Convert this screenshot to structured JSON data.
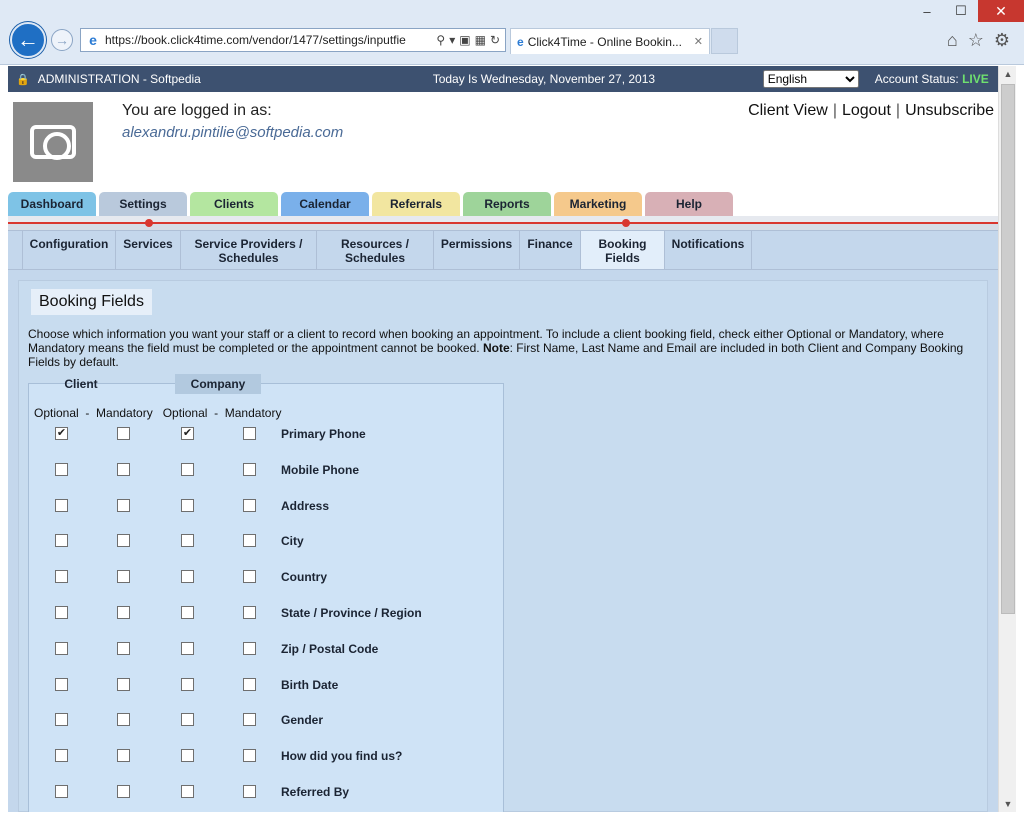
{
  "browser": {
    "window_controls": {
      "minimize": "–",
      "maximize": "☐",
      "close": "✕"
    },
    "address_bar": {
      "url": "https://book.click4time.com/vendor/1477/settings/inputfie"
    },
    "tab": {
      "title": "Click4Time - Online Bookin...",
      "close": "✕"
    },
    "toolbar_icons": [
      "home-icon",
      "star-icon",
      "gear-icon"
    ]
  },
  "topbar": {
    "admin_label": "ADMINISTRATION - Softpedia",
    "date_text": "Today Is Wednesday, November 27, 2013",
    "language": {
      "selected": "English"
    },
    "account_status_label": "Account Status:",
    "account_status_value": "LIVE"
  },
  "user": {
    "logged_in_label": "You are logged in as:",
    "email": "alexandru.pintilie@softpedia.com",
    "links": [
      "Client View",
      "Logout",
      "Unsubscribe"
    ],
    "separator": "|"
  },
  "main_nav": {
    "tabs": [
      {
        "label": "Dashboard",
        "color": "#7ec3e6"
      },
      {
        "label": "Settings",
        "color": "#b9c9dc"
      },
      {
        "label": "Clients",
        "color": "#b4e6a0"
      },
      {
        "label": "Calendar",
        "color": "#7ab0ea"
      },
      {
        "label": "Referrals",
        "color": "#f2e6a0"
      },
      {
        "label": "Reports",
        "color": "#9ed49a"
      },
      {
        "label": "Marketing",
        "color": "#f5c98c"
      },
      {
        "label": "Help",
        "color": "#d8b0b6"
      }
    ],
    "active": "Settings"
  },
  "sub_nav": {
    "tabs": [
      {
        "line1": "Configuration",
        "line2": ""
      },
      {
        "line1": "Services",
        "line2": ""
      },
      {
        "line1": "Service Providers /",
        "line2": "Schedules"
      },
      {
        "line1": "Resources /",
        "line2": "Schedules"
      },
      {
        "line1": "Permissions",
        "line2": ""
      },
      {
        "line1": "Finance",
        "line2": ""
      },
      {
        "line1": "Booking",
        "line2": "Fields"
      },
      {
        "line1": "Notifications",
        "line2": ""
      }
    ],
    "active": "Booking Fields"
  },
  "page": {
    "title": "Booking Fields",
    "intro": "Choose which information you want your staff or a client to record when booking an appointment. To include a client booking field, check either Optional or Mandatory, where Mandatory means the field must be completed or the appointment cannot be booked.",
    "note_label": "Note",
    "note_text": ": First Name, Last Name and Email are included in both Client and Company Booking Fields by default."
  },
  "fields_table": {
    "col_client": "Client",
    "col_company": "Company",
    "subheads": "Optional  -  Mandatory   Optional  -  Mandatory",
    "rows": [
      {
        "label": "Primary Phone",
        "client_optional": true,
        "client_mandatory": false,
        "company_optional": true,
        "company_mandatory": false
      },
      {
        "label": "Mobile Phone",
        "client_optional": false,
        "client_mandatory": false,
        "company_optional": false,
        "company_mandatory": false
      },
      {
        "label": "Address",
        "client_optional": false,
        "client_mandatory": false,
        "company_optional": false,
        "company_mandatory": false
      },
      {
        "label": "City",
        "client_optional": false,
        "client_mandatory": false,
        "company_optional": false,
        "company_mandatory": false
      },
      {
        "label": "Country",
        "client_optional": false,
        "client_mandatory": false,
        "company_optional": false,
        "company_mandatory": false
      },
      {
        "label": "State / Province / Region",
        "client_optional": false,
        "client_mandatory": false,
        "company_optional": false,
        "company_mandatory": false
      },
      {
        "label": "Zip / Postal Code",
        "client_optional": false,
        "client_mandatory": false,
        "company_optional": false,
        "company_mandatory": false
      },
      {
        "label": "Birth Date",
        "client_optional": false,
        "client_mandatory": false,
        "company_optional": false,
        "company_mandatory": false
      },
      {
        "label": "Gender",
        "client_optional": false,
        "client_mandatory": false,
        "company_optional": false,
        "company_mandatory": false
      },
      {
        "label": "How did you find us?",
        "client_optional": false,
        "client_mandatory": false,
        "company_optional": false,
        "company_mandatory": false
      },
      {
        "label": "Referred By",
        "client_optional": false,
        "client_mandatory": false,
        "company_optional": false,
        "company_mandatory": false
      }
    ]
  }
}
